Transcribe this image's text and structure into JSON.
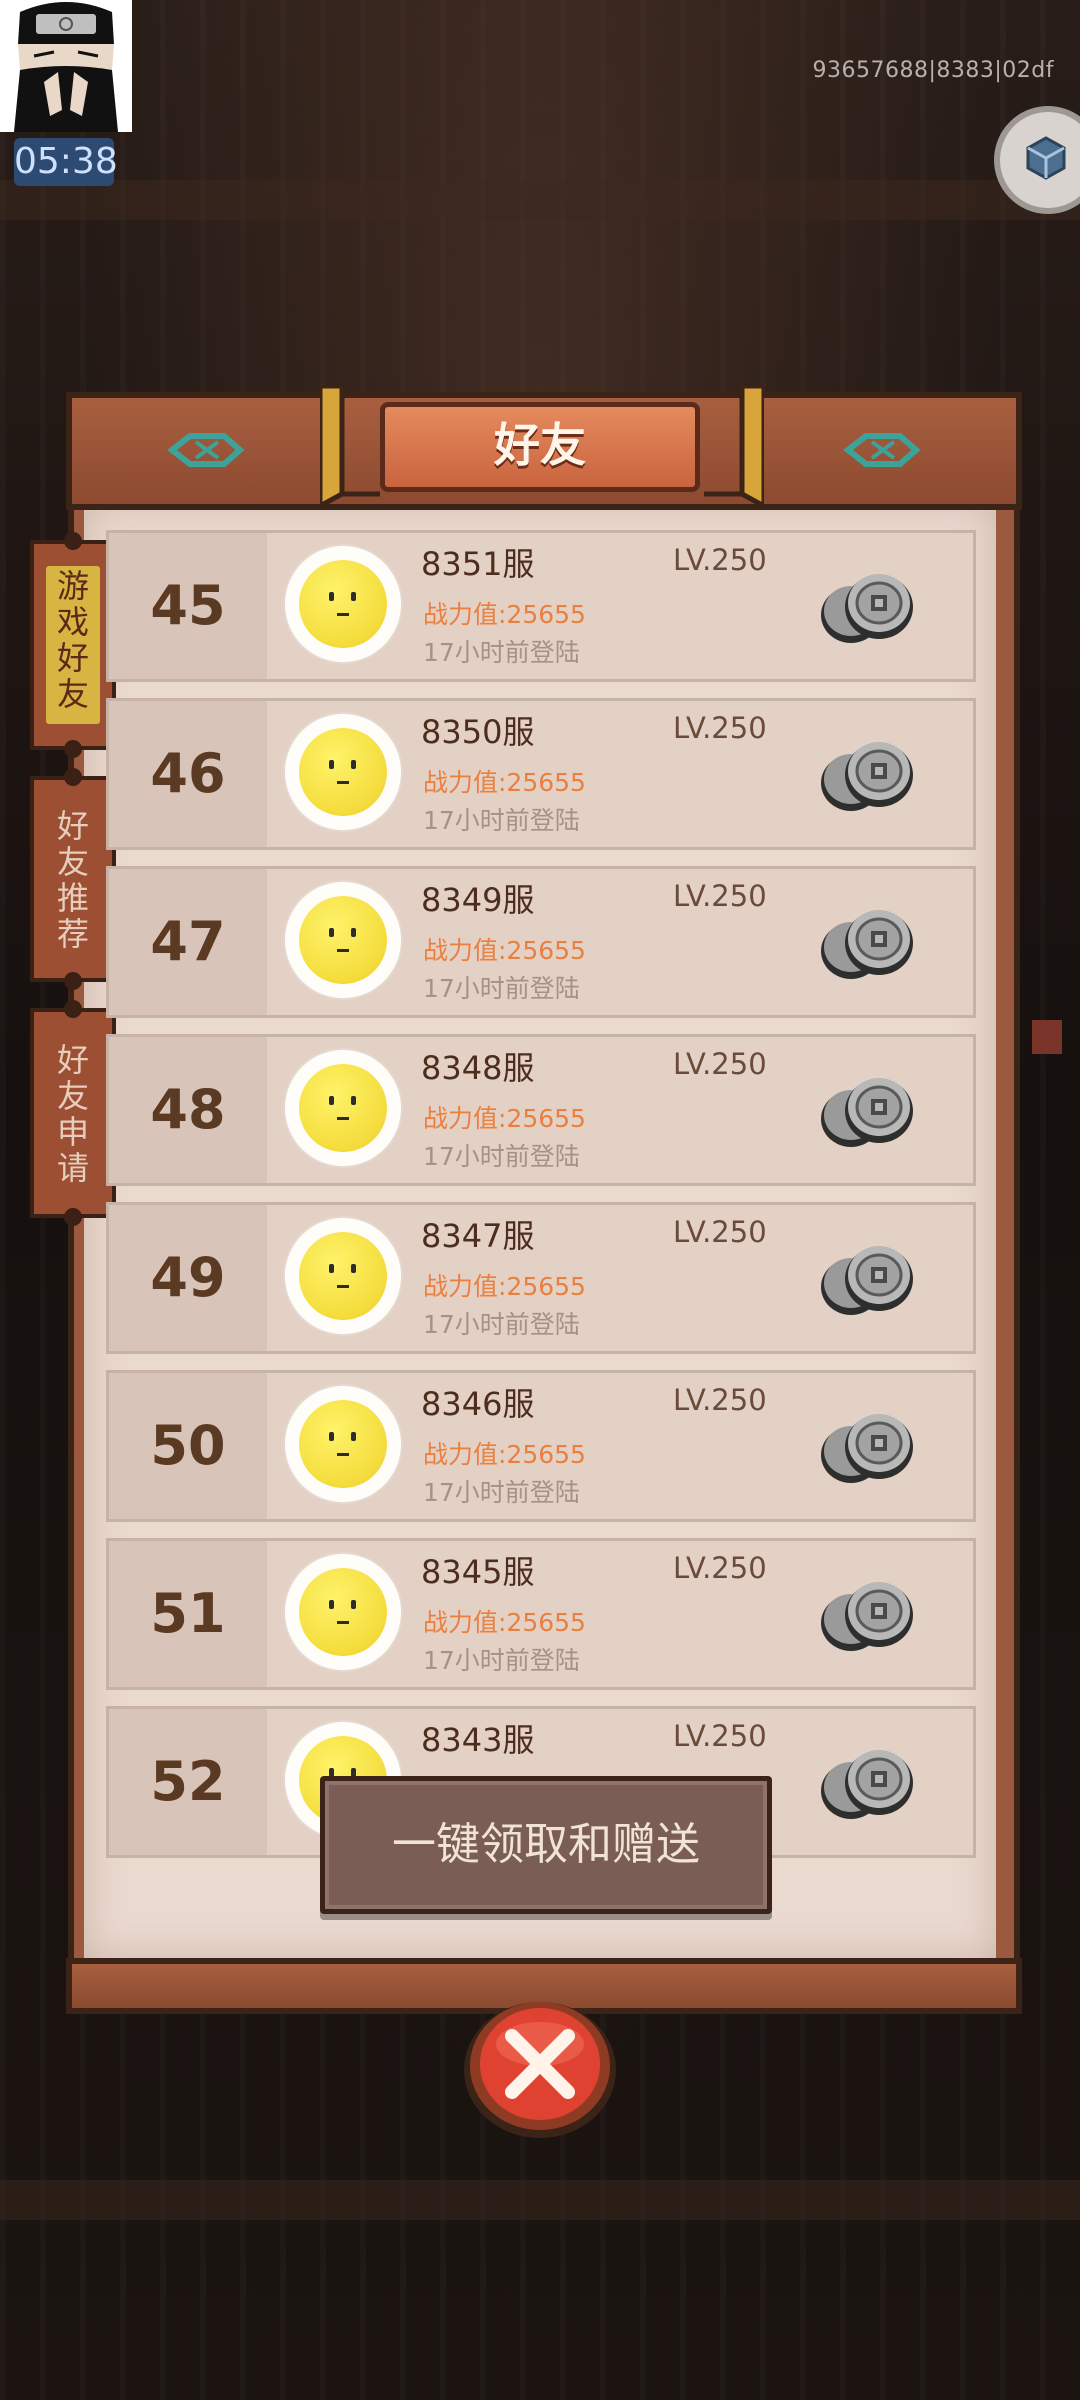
{
  "status": {
    "time": "05:38",
    "session_id": "93657688|8383|02df"
  },
  "title": "好友",
  "tabs": [
    {
      "label": "游戏好友",
      "active": true
    },
    {
      "label": "好友推荐",
      "active": false
    },
    {
      "label": "好友申请",
      "active": false
    }
  ],
  "friends": [
    {
      "rank": "45",
      "server": "8351服",
      "level": "LV.250",
      "power": "战力值:25655",
      "last_login": "17小时前登陆"
    },
    {
      "rank": "46",
      "server": "8350服",
      "level": "LV.250",
      "power": "战力值:25655",
      "last_login": "17小时前登陆"
    },
    {
      "rank": "47",
      "server": "8349服",
      "level": "LV.250",
      "power": "战力值:25655",
      "last_login": "17小时前登陆"
    },
    {
      "rank": "48",
      "server": "8348服",
      "level": "LV.250",
      "power": "战力值:25655",
      "last_login": "17小时前登陆"
    },
    {
      "rank": "49",
      "server": "8347服",
      "level": "LV.250",
      "power": "战力值:25655",
      "last_login": "17小时前登陆"
    },
    {
      "rank": "50",
      "server": "8346服",
      "level": "LV.250",
      "power": "战力值:25655",
      "last_login": "17小时前登陆"
    },
    {
      "rank": "51",
      "server": "8345服",
      "level": "LV.250",
      "power": "战力值:25655",
      "last_login": "17小时前登陆"
    },
    {
      "rank": "52",
      "server": "8343服",
      "level": "LV.250",
      "power": "",
      "last_login": ""
    }
  ],
  "collect_all_label": "一键领取和赠送",
  "icons": {
    "coin": "coin-stack-icon",
    "close": "close-icon",
    "fish": "fish-emblem-icon"
  }
}
